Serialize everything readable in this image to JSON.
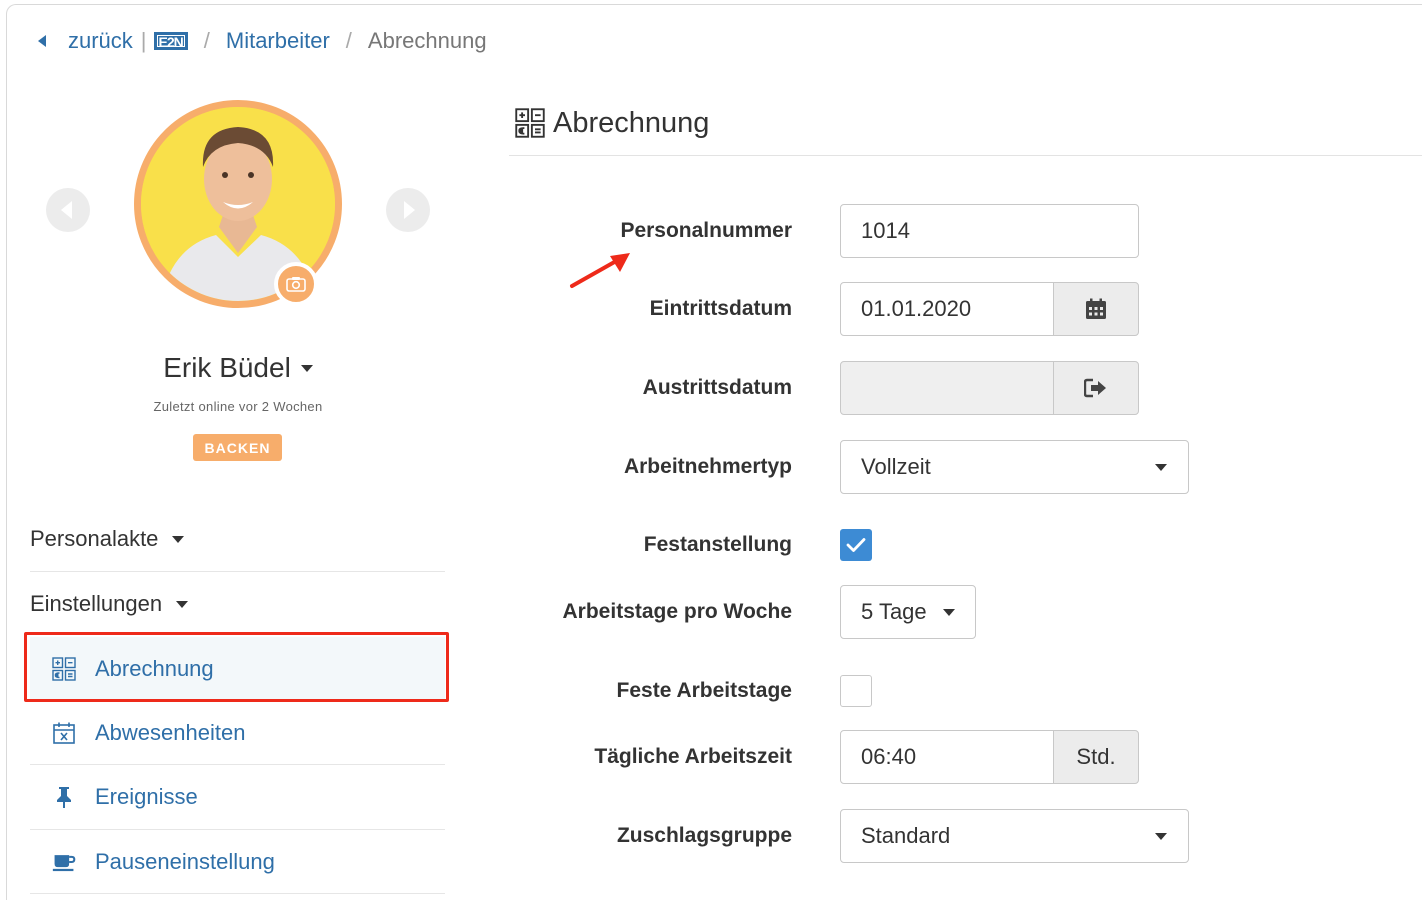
{
  "breadcrumb": {
    "back_label": "zurück",
    "logo_text": "E2N",
    "items": [
      "Mitarbeiter",
      "Abrechnung"
    ]
  },
  "profile": {
    "name": "Erik Büdel",
    "status": "Zuletzt online vor 2 Wochen",
    "badge": "BACKEN",
    "accent_color": "#f7ad6b"
  },
  "sidebar": {
    "sections": [
      {
        "label": "Personalakte"
      },
      {
        "label": "Einstellungen"
      }
    ],
    "items": [
      {
        "label": "Abrechnung",
        "icon": "billing-icon",
        "active": true
      },
      {
        "label": "Abwesenheiten",
        "icon": "calendar-x-icon"
      },
      {
        "label": "Ereignisse",
        "icon": "pin-icon"
      },
      {
        "label": "Pauseneinstellung",
        "icon": "coffee-cup-icon"
      }
    ]
  },
  "panel": {
    "title": "Abrechnung",
    "fields": {
      "personalnummer": {
        "label": "Personalnummer",
        "value": "1014"
      },
      "eintrittsdatum": {
        "label": "Eintrittsdatum",
        "value": "01.01.2020"
      },
      "austrittsdatum": {
        "label": "Austrittsdatum",
        "value": ""
      },
      "arbeitnehmertyp": {
        "label": "Arbeitnehmertyp",
        "value": "Vollzeit"
      },
      "festanstellung": {
        "label": "Festanstellung",
        "checked": true
      },
      "arbeitstage": {
        "label": "Arbeitstage pro Woche",
        "value": "5 Tage"
      },
      "feste_arbeitstage": {
        "label": "Feste Arbeitstage",
        "checked": false
      },
      "arbeitszeit": {
        "label": "Tägliche Arbeitszeit",
        "value": "06:40",
        "unit": "Std."
      },
      "zuschlagsgruppe": {
        "label": "Zuschlagsgruppe",
        "value": "Standard"
      }
    }
  },
  "colors": {
    "link": "#2f6fa8",
    "checkbox": "#3d8bd4",
    "highlight": "#ee2a1a"
  }
}
